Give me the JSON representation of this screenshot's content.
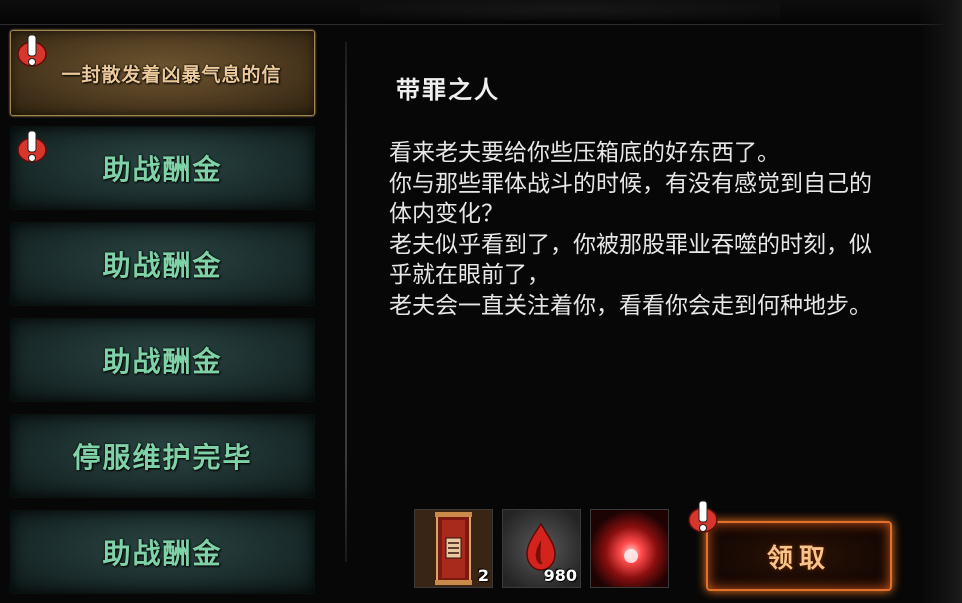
{
  "mail_list": {
    "items": [
      {
        "label": "一封散发着凶暴气息的信",
        "selected": true,
        "alert": true
      },
      {
        "label": "助战酬金",
        "selected": false,
        "alert": true
      },
      {
        "label": "助战酬金",
        "selected": false,
        "alert": false
      },
      {
        "label": "助战酬金",
        "selected": false,
        "alert": false
      },
      {
        "label": "停服维护完毕",
        "selected": false,
        "alert": false
      },
      {
        "label": "助战酬金",
        "selected": false,
        "alert": false
      }
    ]
  },
  "mail": {
    "title": "带罪之人",
    "body": "看来老夫要给你些压箱底的好东西了。\n你与那些罪体战斗的时候，有没有感觉到自己的体内变化？\n老夫似乎看到了，你被那股罪业吞噬的时刻，似乎就在眼前了，\n老夫会一直关注着你，看看你会走到何种地步。"
  },
  "rewards": [
    {
      "icon": "talisman-scroll-icon",
      "count": "2"
    },
    {
      "icon": "red-flame-drop-icon",
      "count": "980"
    },
    {
      "icon": "crimson-orb-icon",
      "count": ""
    }
  ],
  "claim_button": {
    "label": "领取",
    "alert": true
  },
  "colors": {
    "accent_orange": "#e0702a",
    "tab_text_green": "#7fd2a8",
    "selected_text": "#ecc99a",
    "alert_red": "#d9362b"
  }
}
